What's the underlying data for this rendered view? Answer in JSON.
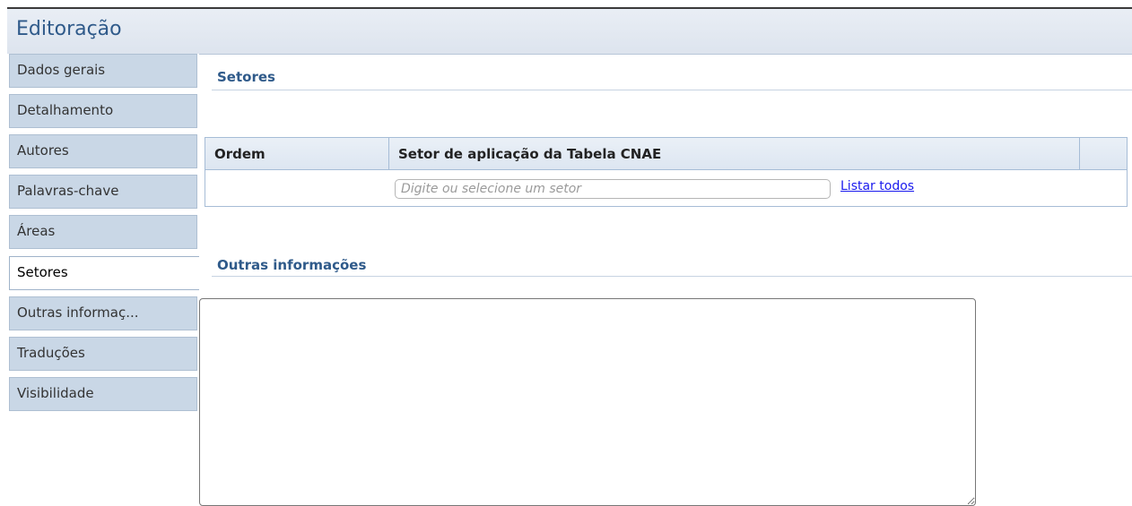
{
  "window": {
    "title": "Editoração"
  },
  "sidebar": {
    "items": [
      {
        "label": "Dados gerais",
        "active": false
      },
      {
        "label": "Detalhamento",
        "active": false
      },
      {
        "label": "Autores",
        "active": false
      },
      {
        "label": "Palavras-chave",
        "active": false
      },
      {
        "label": "Áreas",
        "active": false
      },
      {
        "label": "Setores",
        "active": true
      },
      {
        "label": "Outras informaç...",
        "active": false
      },
      {
        "label": "Traduções",
        "active": false
      },
      {
        "label": "Visibilidade",
        "active": false
      }
    ]
  },
  "main": {
    "setores_section": {
      "title": "Setores",
      "table": {
        "columns": [
          "Ordem",
          "Setor de aplicação da Tabela CNAE",
          ""
        ],
        "input_placeholder": "Digite ou selecione um setor",
        "input_value": "",
        "list_all_link": "Listar todos"
      }
    },
    "outras_section": {
      "title": "Outras informações",
      "textarea_value": ""
    }
  },
  "colors": {
    "accent": "#2f5a8a",
    "tab_bg": "#c9d7e6",
    "link": "#1a1aee"
  }
}
